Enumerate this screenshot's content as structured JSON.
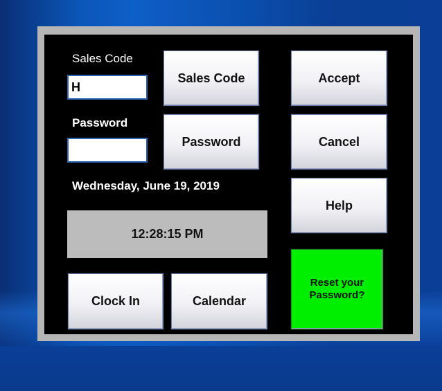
{
  "login": {
    "sales_code_label": "Sales Code",
    "sales_code_value": "H",
    "password_label": "Password",
    "password_value": "",
    "date_text": "Wednesday, June 19, 2019",
    "time_text": "12:28:15 PM"
  },
  "buttons": {
    "sales_code": "Sales Code",
    "password": "Password",
    "accept": "Accept",
    "cancel": "Cancel",
    "help": "Help",
    "reset_password": "Reset your Password?",
    "clock_in": "Clock In",
    "calendar": "Calendar"
  },
  "colors": {
    "panel_background": "#000000",
    "frame": "#b6b6b6",
    "reset_button": "#00ee00",
    "clock_background": "#bcbcbc",
    "desktop": "#0b56b8"
  }
}
